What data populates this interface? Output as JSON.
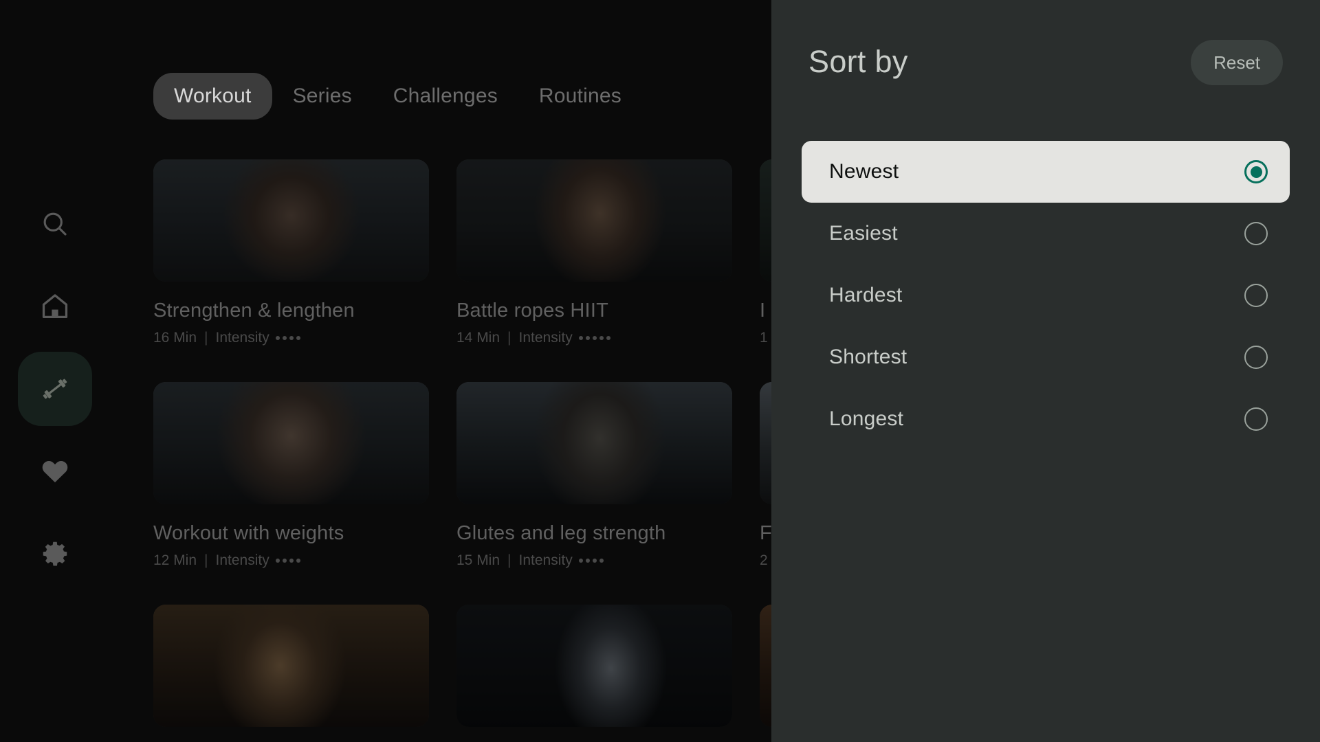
{
  "sidebar": {
    "items": [
      {
        "icon": "search-icon",
        "name": "search",
        "active": false
      },
      {
        "icon": "home-icon",
        "name": "home",
        "active": false
      },
      {
        "icon": "dumbbell-icon",
        "name": "workouts",
        "active": true
      },
      {
        "icon": "heart-icon",
        "name": "favorites",
        "active": false
      },
      {
        "icon": "gear-icon",
        "name": "settings",
        "active": false
      }
    ]
  },
  "tabs": [
    {
      "label": "Workout",
      "active": true
    },
    {
      "label": "Series",
      "active": false
    },
    {
      "label": "Challenges",
      "active": false
    },
    {
      "label": "Routines",
      "active": false
    }
  ],
  "cards": [
    {
      "title": "Strengthen & lengthen",
      "duration": "16 Min",
      "sep": "|",
      "intensity_label": "Intensity",
      "intensity": 4,
      "image": "woman-gym-portrait"
    },
    {
      "title": "Battle ropes HIIT",
      "duration": "14 Min",
      "sep": "|",
      "intensity_label": "Intensity",
      "intensity": 5,
      "image": "man-battle-ropes"
    },
    {
      "title": "I",
      "duration": "1",
      "sep": "",
      "intensity_label": "",
      "intensity": 0,
      "image": "clipped-card-top-right"
    },
    {
      "title": "Workout with weights",
      "duration": "12 Min",
      "sep": "|",
      "intensity_label": "Intensity",
      "intensity": 4,
      "image": "woman-rowing-machine"
    },
    {
      "title": "Glutes and leg strength",
      "duration": "15 Min",
      "sep": "|",
      "intensity_label": "Intensity",
      "intensity": 4,
      "image": "woman-city-rooftop"
    },
    {
      "title": "F",
      "duration": "2",
      "sep": "",
      "intensity_label": "",
      "intensity": 0,
      "image": "clipped-card-mid-right"
    },
    {
      "title": "",
      "duration": "",
      "sep": "",
      "intensity_label": "",
      "intensity": 0,
      "image": "man-pushup-gym"
    },
    {
      "title": "",
      "duration": "",
      "sep": "",
      "intensity_label": "",
      "intensity": 0,
      "image": "man-dumbbell-curl"
    },
    {
      "title": "",
      "duration": "",
      "sep": "",
      "intensity_label": "",
      "intensity": 0,
      "image": "clipped-card-bottom-right"
    }
  ],
  "panel": {
    "title": "Sort by",
    "reset_label": "Reset",
    "options": [
      {
        "label": "Newest",
        "selected": true
      },
      {
        "label": "Easiest",
        "selected": false
      },
      {
        "label": "Hardest",
        "selected": false
      },
      {
        "label": "Shortest",
        "selected": false
      },
      {
        "label": "Longest",
        "selected": false
      }
    ]
  },
  "colors": {
    "app_background": "#0a0a0a",
    "panel_background": "#2a2e2d",
    "selected_row_background": "#e4e4e1",
    "accent_green": "#06705c",
    "reset_button_background": "#3a403e",
    "active_tab_background": "#3c3c3c",
    "active_nav_background": "#16201c",
    "muted_text": "#6d6d6d"
  }
}
